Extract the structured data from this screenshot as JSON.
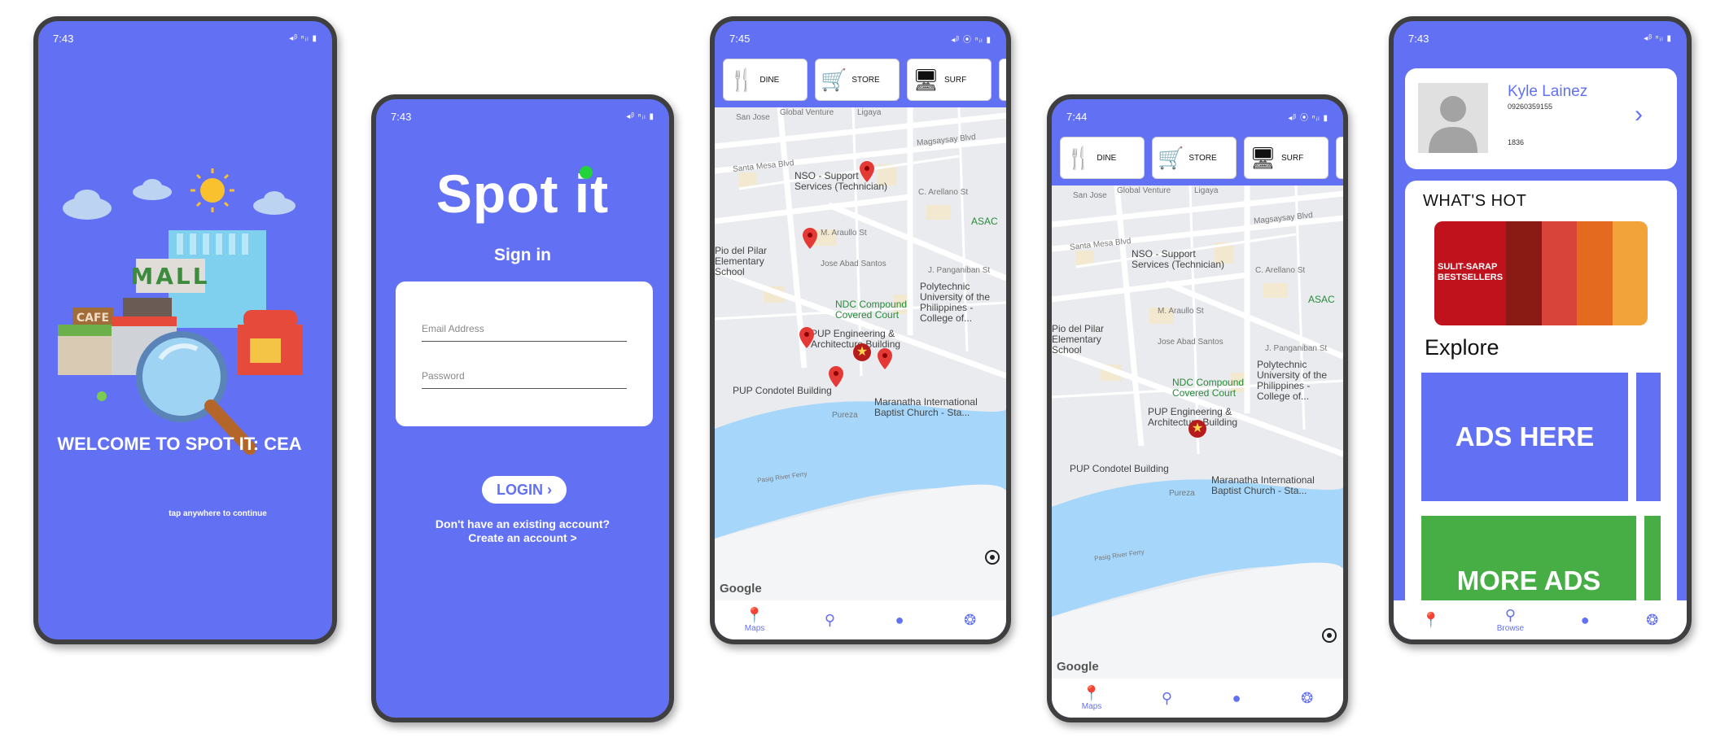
{
  "screen1": {
    "time": "7:43",
    "status_icons": "◂ᵝ ⁿᵢₗ ▮",
    "welcome": "WELCOME TO SPOT IT: CEA",
    "mall_sign": "MALL",
    "cafe_sign": "CAFE",
    "tap": "tap anywhere to continue"
  },
  "screen2": {
    "time": "7:43",
    "status_icons": "◂ᵝ ⁿᵢₗ ▮",
    "brand": "Spot it",
    "signin": "Sign in",
    "email_placeholder": "Email Address",
    "password_placeholder": "Password",
    "login": "LOGIN",
    "no_account": "Don't have an existing account?",
    "create": "Create an account >"
  },
  "screen3": {
    "time": "7:45",
    "status_icons": "◂ᵝ ⦿ ⁿᵢₗ ▮",
    "categories": [
      "DINE",
      "STORE",
      "SURF"
    ],
    "labels": {
      "sanjose": "San Jose",
      "global": "Global Venture",
      "ligaya": "Ligaya",
      "magsaysay": "Magsaysay Blvd",
      "santamesa": "Santa Mesa Blvd",
      "nso": "NSO - Support Services (Technician)",
      "arellano": "C. Arellano St",
      "asac": "ASAC",
      "araullo": "M. Araullo St",
      "piodelpilar": "Pio del Pilar Elementary School",
      "abadsantos": "Jose Abad Santos",
      "panganiban": "J. Panganiban St",
      "ndc": "NDC Compound Covered Court",
      "polytechnic": "Polytechnic University of the Philippines - College of...",
      "pupeng": "PUP Engineering & Architecture Building",
      "condotel": "PUP Condotel Building",
      "maranatha": "Maranatha International Baptist Church - Sta...",
      "pureza": "Pureza",
      "pasig": "Pasig River Ferry"
    },
    "google": "Google",
    "nav": [
      "Maps",
      "",
      "",
      ""
    ]
  },
  "screen4": {
    "time": "7:44",
    "status_icons": "◂ᵝ ⦿ ⁿᵢₗ ▮",
    "categories": [
      "DINE",
      "STORE",
      "SURF"
    ],
    "google": "Google",
    "nav": [
      "Maps",
      "",
      "",
      ""
    ]
  },
  "screen5": {
    "time": "7:43",
    "status_icons": "◂ᵝ ⁿᵢₗ ▮",
    "name": "Kyle Lainez",
    "phone": "09260359155",
    "number": "1836",
    "whats_hot": "WHAT'S HOT",
    "promo_text": "SULIT-SARAP BESTSELLERS",
    "explore": "Explore",
    "ad1": "ADS HERE",
    "ad2": "MORE ADS",
    "nav": [
      "",
      "Browse",
      "",
      ""
    ]
  },
  "colors": {
    "primary": "#6270f4",
    "green": "#46ae44",
    "pin_red": "#e53935"
  }
}
